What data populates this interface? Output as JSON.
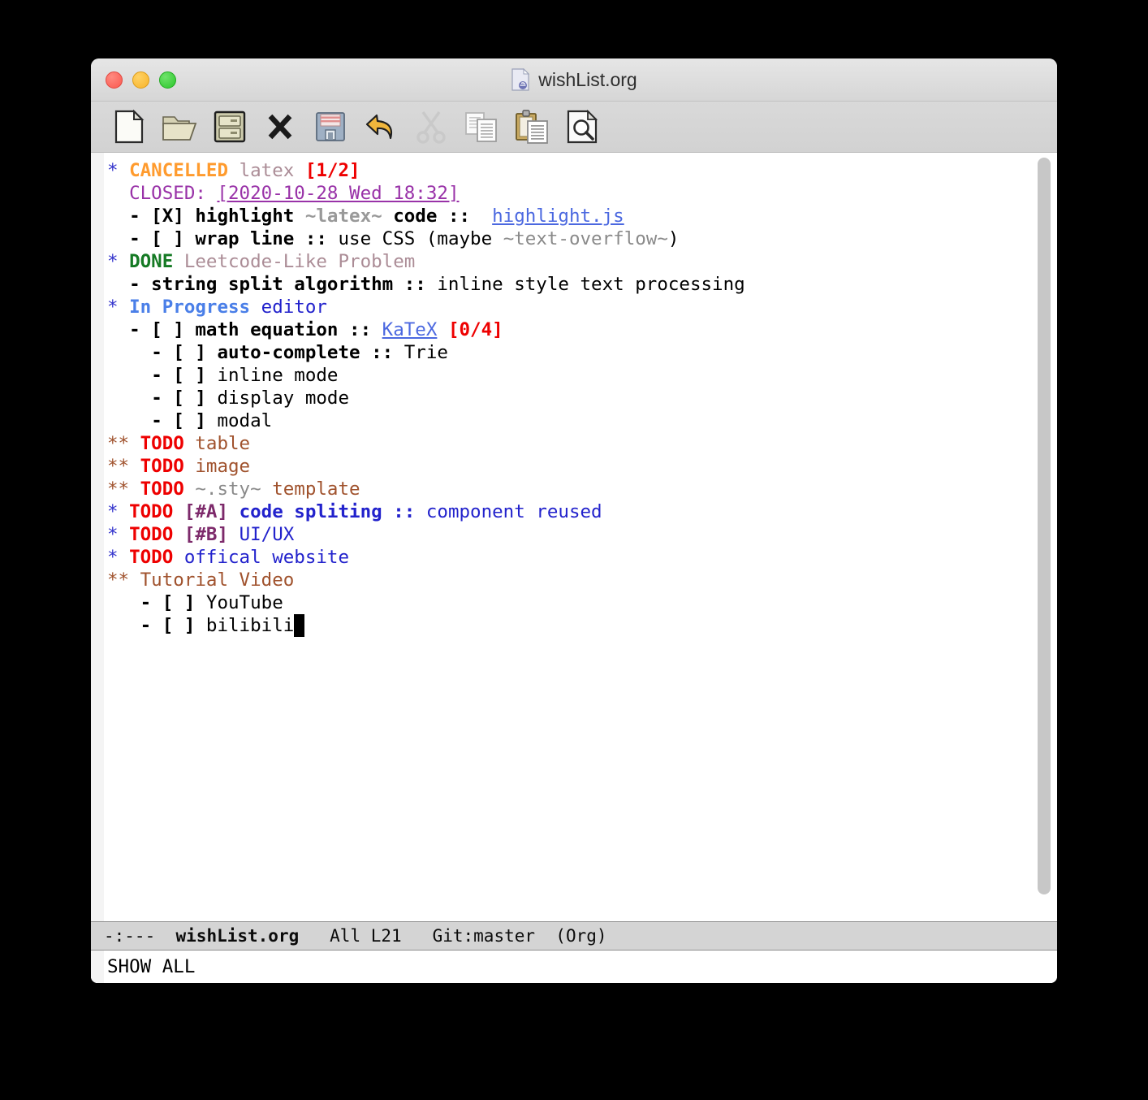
{
  "window": {
    "title": "wishList.org",
    "title_icon": "org-document-icon",
    "traffic_lights": [
      {
        "name": "close-button",
        "label": "Close",
        "color": "#f9584f"
      },
      {
        "name": "minimize-button",
        "label": "Minimize",
        "color": "#f7b32b"
      },
      {
        "name": "maximize-button",
        "label": "Maximize",
        "color": "#2bc62b"
      }
    ]
  },
  "toolbar": {
    "buttons": [
      {
        "icon": "new-file-icon",
        "label": "New File"
      },
      {
        "icon": "open-folder-icon",
        "label": "Open File"
      },
      {
        "icon": "file-cabinet-icon",
        "label": "Dired"
      },
      {
        "icon": "close-x-icon",
        "label": "Close Buffer"
      },
      {
        "icon": "floppy-save-icon",
        "label": "Save"
      },
      {
        "icon": "undo-arrow-icon",
        "label": "Undo"
      },
      {
        "icon": "scissors-cut-icon",
        "label": "Cut"
      },
      {
        "icon": "copy-pages-icon",
        "label": "Copy"
      },
      {
        "icon": "clipboard-paste-icon",
        "label": "Paste"
      },
      {
        "icon": "magnifier-page-icon",
        "label": "Search"
      }
    ]
  },
  "buffer": {
    "lines": [
      {
        "id": "line-1",
        "kind": "heading",
        "segments": [
          {
            "cls": "org-star-1",
            "t": "*"
          },
          {
            "cls": "plain",
            "t": " "
          },
          {
            "cls": "kw-cancelled",
            "t": "CANCELLED"
          },
          {
            "cls": "plain",
            "t": " "
          },
          {
            "cls": "lvl1-done",
            "t": "latex"
          },
          {
            "cls": "plain",
            "t": " "
          },
          {
            "cls": "cookie",
            "t": "[1/2]"
          }
        ]
      },
      {
        "id": "line-2",
        "kind": "planning",
        "segments": [
          {
            "cls": "plain",
            "t": "  "
          },
          {
            "cls": "closed-kw",
            "t": "CLOSED: "
          },
          {
            "cls": "timestamp",
            "t": "[2020-10-28 Wed 18:32]"
          }
        ]
      },
      {
        "id": "line-3",
        "kind": "checkbox-item",
        "segments": [
          {
            "cls": "plain",
            "t": "  "
          },
          {
            "cls": "bold",
            "t": "- [X] highlight "
          },
          {
            "cls": "verbatim",
            "t": "~latex~"
          },
          {
            "cls": "bold",
            "t": " code :: "
          },
          {
            "cls": "plain",
            "t": " "
          },
          {
            "cls": "link",
            "t": "highlight.js"
          }
        ]
      },
      {
        "id": "line-4",
        "kind": "checkbox-item",
        "segments": [
          {
            "cls": "plain",
            "t": "  "
          },
          {
            "cls": "bold",
            "t": "- [ ] wrap line :: "
          },
          {
            "cls": "plain",
            "t": "use CSS (maybe "
          },
          {
            "cls": "verbatim-r",
            "t": "~text-overflow~"
          },
          {
            "cls": "plain",
            "t": ")"
          }
        ]
      },
      {
        "id": "line-5",
        "kind": "heading",
        "segments": [
          {
            "cls": "org-star-1",
            "t": "*"
          },
          {
            "cls": "plain",
            "t": " "
          },
          {
            "cls": "kw-done",
            "t": "DONE"
          },
          {
            "cls": "plain",
            "t": " "
          },
          {
            "cls": "lvl1-done",
            "t": "Leetcode-Like Problem"
          }
        ]
      },
      {
        "id": "line-6",
        "kind": "item",
        "segments": [
          {
            "cls": "plain",
            "t": "  "
          },
          {
            "cls": "bold",
            "t": "- string split algorithm :: "
          },
          {
            "cls": "plain",
            "t": "inline style text processing"
          }
        ]
      },
      {
        "id": "line-7",
        "kind": "heading",
        "segments": [
          {
            "cls": "org-star-1",
            "t": "*"
          },
          {
            "cls": "plain",
            "t": " "
          },
          {
            "cls": "kw-inprog",
            "t": "In Progress"
          },
          {
            "cls": "plain",
            "t": " "
          },
          {
            "cls": "lvl1-title",
            "t": "editor"
          }
        ]
      },
      {
        "id": "line-8",
        "kind": "checkbox-item",
        "segments": [
          {
            "cls": "plain",
            "t": "  "
          },
          {
            "cls": "bold",
            "t": "- [ ] math equation :: "
          },
          {
            "cls": "link",
            "t": "KaTeX"
          },
          {
            "cls": "plain",
            "t": " "
          },
          {
            "cls": "cookie",
            "t": "[0/4]"
          }
        ]
      },
      {
        "id": "line-9",
        "kind": "checkbox-item",
        "segments": [
          {
            "cls": "plain",
            "t": "    "
          },
          {
            "cls": "bold",
            "t": "- [ ] auto-complete :: "
          },
          {
            "cls": "plain",
            "t": "Trie"
          }
        ]
      },
      {
        "id": "line-10",
        "kind": "checkbox-item",
        "segments": [
          {
            "cls": "plain",
            "t": "    "
          },
          {
            "cls": "bold",
            "t": "- [ ] "
          },
          {
            "cls": "plain",
            "t": "inline mode"
          }
        ]
      },
      {
        "id": "line-11",
        "kind": "checkbox-item",
        "segments": [
          {
            "cls": "plain",
            "t": "    "
          },
          {
            "cls": "bold",
            "t": "- [ ] "
          },
          {
            "cls": "plain",
            "t": "display mode"
          }
        ]
      },
      {
        "id": "line-12",
        "kind": "checkbox-item",
        "segments": [
          {
            "cls": "plain",
            "t": "    "
          },
          {
            "cls": "bold",
            "t": "- [ ] "
          },
          {
            "cls": "plain",
            "t": "modal"
          }
        ]
      },
      {
        "id": "line-13",
        "kind": "heading",
        "segments": [
          {
            "cls": "org-star-2",
            "t": "**"
          },
          {
            "cls": "plain",
            "t": " "
          },
          {
            "cls": "kw-todo",
            "t": "TODO"
          },
          {
            "cls": "plain",
            "t": " "
          },
          {
            "cls": "lvl2-title",
            "t": "table"
          }
        ]
      },
      {
        "id": "line-14",
        "kind": "heading",
        "segments": [
          {
            "cls": "org-star-2",
            "t": "**"
          },
          {
            "cls": "plain",
            "t": " "
          },
          {
            "cls": "kw-todo",
            "t": "TODO"
          },
          {
            "cls": "plain",
            "t": " "
          },
          {
            "cls": "lvl2-title",
            "t": "image"
          }
        ]
      },
      {
        "id": "line-15",
        "kind": "heading",
        "segments": [
          {
            "cls": "org-star-2",
            "t": "**"
          },
          {
            "cls": "plain",
            "t": " "
          },
          {
            "cls": "kw-todo",
            "t": "TODO"
          },
          {
            "cls": "plain",
            "t": " "
          },
          {
            "cls": "verbatim-r",
            "t": "~.sty~"
          },
          {
            "cls": "plain",
            "t": " "
          },
          {
            "cls": "lvl2-title",
            "t": "template"
          }
        ]
      },
      {
        "id": "line-16",
        "kind": "heading",
        "segments": [
          {
            "cls": "org-star-1",
            "t": "*"
          },
          {
            "cls": "plain",
            "t": " "
          },
          {
            "cls": "kw-todo",
            "t": "TODO"
          },
          {
            "cls": "plain",
            "t": " "
          },
          {
            "cls": "priority",
            "t": "[#A]"
          },
          {
            "cls": "plain",
            "t": " "
          },
          {
            "cls": "lvl1-title bold",
            "t": "code spliting :: "
          },
          {
            "cls": "lvl1-title",
            "t": "component reused"
          }
        ]
      },
      {
        "id": "line-17",
        "kind": "heading",
        "segments": [
          {
            "cls": "org-star-1",
            "t": "*"
          },
          {
            "cls": "plain",
            "t": " "
          },
          {
            "cls": "kw-todo",
            "t": "TODO"
          },
          {
            "cls": "plain",
            "t": " "
          },
          {
            "cls": "priority",
            "t": "[#B]"
          },
          {
            "cls": "plain",
            "t": " "
          },
          {
            "cls": "lvl1-title",
            "t": "UI/UX"
          }
        ]
      },
      {
        "id": "line-18",
        "kind": "heading",
        "segments": [
          {
            "cls": "org-star-1",
            "t": "*"
          },
          {
            "cls": "plain",
            "t": " "
          },
          {
            "cls": "kw-todo",
            "t": "TODO"
          },
          {
            "cls": "plain",
            "t": " "
          },
          {
            "cls": "lvl1-title",
            "t": "offical website"
          }
        ]
      },
      {
        "id": "line-19",
        "kind": "heading",
        "segments": [
          {
            "cls": "org-star-2",
            "t": "**"
          },
          {
            "cls": "plain",
            "t": " "
          },
          {
            "cls": "lvl2-title",
            "t": "Tutorial Video"
          }
        ]
      },
      {
        "id": "line-20",
        "kind": "checkbox-item",
        "segments": [
          {
            "cls": "plain",
            "t": "   "
          },
          {
            "cls": "bold",
            "t": "- [ ] "
          },
          {
            "cls": "plain",
            "t": "YouTube"
          }
        ]
      },
      {
        "id": "line-21",
        "kind": "checkbox-item",
        "segments": [
          {
            "cls": "plain",
            "t": "   "
          },
          {
            "cls": "bold",
            "t": "- [ ] "
          },
          {
            "cls": "plain",
            "t": "bilibili"
          },
          {
            "cls": "cursor-block",
            "t": " "
          }
        ]
      }
    ]
  },
  "modeline": {
    "prefix": "-:---  ",
    "buffer_name": "wishList.org",
    "suffix": "   All L21   Git:master  (Org)"
  },
  "minibuffer": {
    "message": "SHOW ALL"
  }
}
